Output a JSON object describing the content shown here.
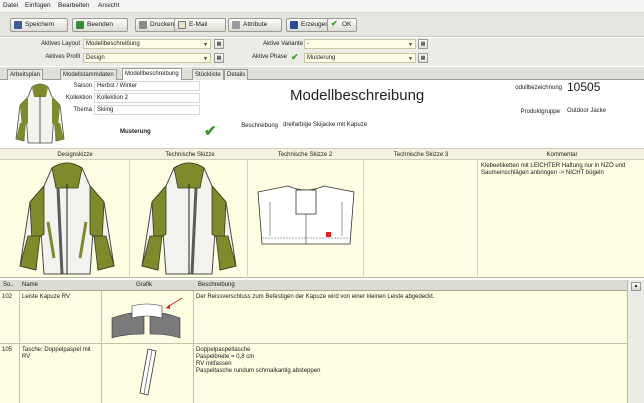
{
  "menu": [
    "Datei",
    "Einfügen",
    "Bearbeiten",
    "Ansicht"
  ],
  "toolbar": {
    "save": "Speichern",
    "finish": "Beenden",
    "print": "Drucken",
    "email": "E-Mail",
    "attributes": "Attribute",
    "create": "Erzeugen",
    "ok": "OK"
  },
  "fields": {
    "active_layout_label": "Aktives Layout",
    "active_layout_value": "Modellbeschreibung",
    "active_profile_label": "Aktives Profil",
    "active_profile_value": "Design",
    "active_variant_label": "Aktive Variante",
    "active_variant_value": "-",
    "active_phase_label": "Aktive Phase",
    "active_phase_value": "Musterung"
  },
  "tabs": [
    "Arbeitsplan",
    "Modellstammdaten",
    "Modellbeschreibung",
    "Stückliste",
    "Details"
  ],
  "active_tab_index": 2,
  "header": {
    "season_label": "Saison",
    "season_value": "Herbst / Winter",
    "collection_label": "Kollektion",
    "collection_value": "Kollektion 2",
    "theme_label": "Thema",
    "theme_value": "Skiing",
    "phase_status": "Musterung",
    "title": "Modellbeschreibung",
    "description_label": "Beschreibung",
    "description_value": "dreifarbige Skijacke mit Kapuze",
    "model_label": "odullbezeichnung",
    "model_value": "10505",
    "product_group_label": "Produktgruppe",
    "product_group_value": "Outdoor Jacke"
  },
  "sketches": {
    "col1": "Designskizze",
    "col2": "Technische Skizze",
    "col3": "Technische Skizze 2",
    "col4": "Technische Skizze 3",
    "col5": "Kommentar",
    "comment": "Klebeetiketten mit LEICHTER Haftung nur in NZÖ und Saumeinschlägen anbringen -> NICHT bügeln"
  },
  "table": {
    "headers": [
      "So..",
      "Name",
      "Grafik",
      "Beschreibung"
    ],
    "rows": [
      {
        "num": "102",
        "name": "Leiste Kapuze RV",
        "desc_lines": [
          "Der Reissverschluss zum Befestigen der Kapuze wird von einer kleinen Leiste abgedeckt."
        ]
      },
      {
        "num": "105",
        "name": "Tasche: Doppelpaspel mit RV",
        "desc_lines": [
          "Doppelpaspeltasche",
          "Paspelbreite = 0,8 cm",
          "RV mitfassen",
          "Paspeltasche rundum schmalkantig absteppen"
        ]
      }
    ]
  },
  "colors": {
    "jacket_olive": "#7f8a2a",
    "jacket_white": "#f2f2ee",
    "jacket_grey": "#5a5a5a",
    "check_green": "#3a9a28"
  }
}
